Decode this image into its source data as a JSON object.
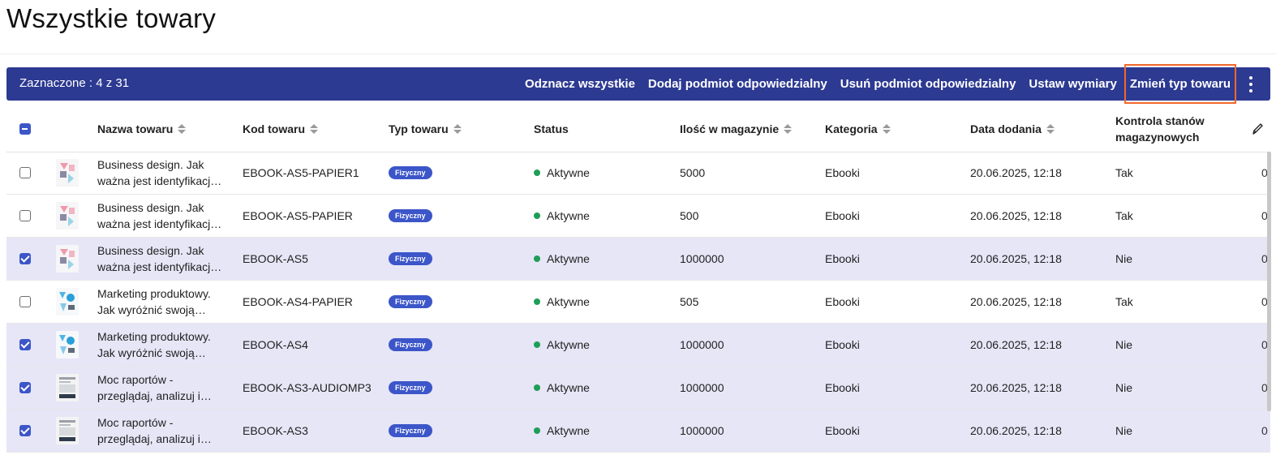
{
  "page": {
    "title": "Wszystkie towary"
  },
  "bulk_bar": {
    "selected_text": "Zaznaczone : 4 z 31",
    "actions": [
      "Odznacz wszystkie",
      "Dodaj podmiot odpowiedzialny",
      "Usuń podmiot odpowiedzialny",
      "Ustaw wymiary",
      "Zmień typ towaru"
    ],
    "highlight_color": "#f2682a",
    "bar_color": "#2d3a92"
  },
  "table": {
    "headers": {
      "name": "Nazwa towaru",
      "code": "Kod towaru",
      "type": "Typ towaru",
      "status": "Status",
      "stock": "Ilość w magazynie",
      "category": "Kategoria",
      "date": "Data dodania",
      "stock_control": "Kontrola stanów magazynowych"
    },
    "rows": [
      {
        "checked": false,
        "thumb": "pink",
        "name": "Business design. Jak ważna jest identyfikacj…",
        "code": "EBOOK-AS5-PAPIER1",
        "type": "Fizyczny",
        "status": "Aktywne",
        "stock": "5000",
        "category": "Ebooki",
        "date": "20.06.2025, 12:18",
        "control": "Tak",
        "edge": "0"
      },
      {
        "checked": false,
        "thumb": "pink",
        "name": "Business design. Jak ważna jest identyfikacj…",
        "code": "EBOOK-AS5-PAPIER",
        "type": "Fizyczny",
        "status": "Aktywne",
        "stock": "500",
        "category": "Ebooki",
        "date": "20.06.2025, 12:18",
        "control": "Tak",
        "edge": "0"
      },
      {
        "checked": true,
        "thumb": "pink",
        "name": "Business design. Jak ważna jest identyfikacj…",
        "code": "EBOOK-AS5",
        "type": "Fizyczny",
        "status": "Aktywne",
        "stock": "1000000",
        "category": "Ebooki",
        "date": "20.06.2025, 12:18",
        "control": "Nie",
        "edge": "0"
      },
      {
        "checked": false,
        "thumb": "blue",
        "name": "Marketing produktowy. Jak wyróżnić swoją…",
        "code": "EBOOK-AS4-PAPIER",
        "type": "Fizyczny",
        "status": "Aktywne",
        "stock": "505",
        "category": "Ebooki",
        "date": "20.06.2025, 12:18",
        "control": "Tak",
        "edge": "0"
      },
      {
        "checked": true,
        "thumb": "blue",
        "name": "Marketing produktowy. Jak wyróżnić swoją…",
        "code": "EBOOK-AS4",
        "type": "Fizyczny",
        "status": "Aktywne",
        "stock": "1000000",
        "category": "Ebooki",
        "date": "20.06.2025, 12:18",
        "control": "Nie",
        "edge": "0"
      },
      {
        "checked": true,
        "thumb": "gray",
        "name": "Moc raportów - przeglądaj, analizuj i…",
        "code": "EBOOK-AS3-AUDIOMP3",
        "type": "Fizyczny",
        "status": "Aktywne",
        "stock": "1000000",
        "category": "Ebooki",
        "date": "20.06.2025, 12:18",
        "control": "Nie",
        "edge": "0"
      },
      {
        "checked": true,
        "thumb": "gray",
        "name": "Moc raportów - przeglądaj, analizuj i…",
        "code": "EBOOK-AS3",
        "type": "Fizyczny",
        "status": "Aktywne",
        "stock": "1000000",
        "category": "Ebooki",
        "date": "20.06.2025, 12:18",
        "control": "Nie",
        "edge": "0"
      }
    ]
  }
}
